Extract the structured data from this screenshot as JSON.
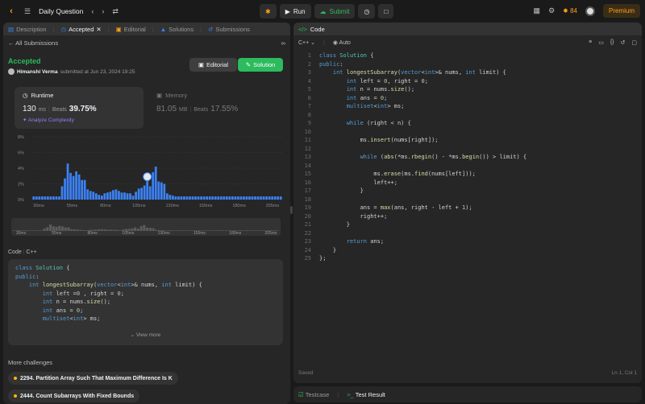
{
  "header": {
    "title": "Daily Question",
    "run": "Run",
    "submit": "Submit",
    "streak": "84",
    "premium": "Premium"
  },
  "left_tabs": [
    {
      "label": "Description"
    },
    {
      "label": "Accepted"
    },
    {
      "label": "Editorial"
    },
    {
      "label": "Solutions"
    },
    {
      "label": "Submissions"
    }
  ],
  "back": "All Submissions",
  "status": "Accepted",
  "author": {
    "name": "Himanshi Verma",
    "text": "submitted at Jun 23, 2024 19:25"
  },
  "buttons": {
    "editorial": "Editorial",
    "solution": "Solution"
  },
  "runtime": {
    "label": "Runtime",
    "value": "130",
    "unit": "ms",
    "beats_label": "Beats",
    "beats": "39.75%",
    "link": "Analyze Complexity"
  },
  "memory": {
    "label": "Memory",
    "value": "81.05",
    "unit": "MB",
    "beats_label": "Beats",
    "beats": "17.55%"
  },
  "chart_data": {
    "type": "bar",
    "yticks": [
      "8%",
      "6%",
      "4%",
      "2%",
      "0%"
    ],
    "ylim": [
      0,
      8
    ],
    "xticks": [
      "30ms",
      "55ms",
      "80ms",
      "105ms",
      "130ms",
      "155ms",
      "180ms",
      "205ms"
    ],
    "values": [
      0.4,
      0.4,
      0.4,
      0.4,
      0.4,
      0.4,
      0.4,
      0.4,
      0.4,
      0.4,
      1.7,
      2.7,
      4.6,
      3.4,
      3.0,
      3.6,
      3.2,
      2.5,
      2.5,
      1.3,
      1.1,
      1.0,
      0.8,
      0.6,
      0.5,
      0.8,
      0.9,
      1.0,
      1.2,
      1.3,
      1.1,
      0.9,
      0.9,
      0.8,
      0.8,
      0.5,
      1.0,
      1.4,
      1.5,
      1.8,
      2.5,
      1.7,
      3.5,
      4.2,
      2.3,
      2.2,
      2.0,
      0.8,
      0.6,
      0.5,
      0.4,
      0.4,
      0.4,
      0.4,
      0.4,
      0.4,
      0.4,
      0.4,
      0.4,
      0.4,
      0.4,
      0.4,
      0.4,
      0.4,
      0.4,
      0.4,
      0.4,
      0.4,
      0.4,
      0.4,
      0.4,
      0.4,
      0.4,
      0.4,
      0.4,
      0.4,
      0.4,
      0.4,
      0.4,
      0.4,
      0.4,
      0.4,
      0.4,
      0.4,
      0.4,
      0.4,
      0.4,
      0.4
    ],
    "highlight_index": 40,
    "grid": true
  },
  "code_label": "Code",
  "code_lang": "C++",
  "preview_lines": [
    "class Solution {",
    "public:",
    "    int longestSubarray(vector<int>& nums, int limit) {",
    "        int left =0 , right = 0;",
    "        int n = nums.size();",
    "        int ans = 0;",
    "        multiset<int> ms;"
  ],
  "view_more": "View more",
  "more_challenges": "More challenges",
  "challenges": [
    "2294. Partition Array Such That Maximum Difference Is K",
    "2444. Count Subarrays With Fixed Bounds"
  ],
  "editor": {
    "tab": "Code",
    "lang": "C++",
    "auto": "Auto",
    "saved": "Saved",
    "position": "Ln 1, Col 1"
  },
  "code_lines": [
    "class Solution {",
    "public:",
    "    int longestSubarray(vector<int>& nums, int limit) {",
    "        int left = 0, right = 0;",
    "        int n = nums.size();",
    "        int ans = 0;",
    "        multiset<int> ms;",
    "",
    "        while (right < n) {",
    "",
    "            ms.insert(nums[right]);",
    "",
    "            while (abs(*ms.rbegin() - *ms.begin()) > limit) {",
    "",
    "                ms.erase(ms.find(nums[left]));",
    "                left++;",
    "            }",
    "",
    "            ans = max(ans, right - left + 1);",
    "            right++;",
    "        }",
    "",
    "        return ans;",
    "    }",
    "};"
  ],
  "bottom_tabs": [
    "Testcase",
    "Test Result"
  ]
}
